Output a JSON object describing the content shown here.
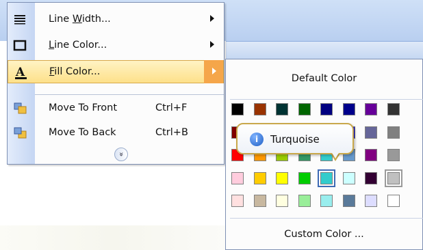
{
  "menu": {
    "items": [
      {
        "label": "Line Width...",
        "shortcut": ""
      },
      {
        "label": "Line Color...",
        "shortcut": ""
      },
      {
        "label": "Fill Color...",
        "shortcut": ""
      },
      {
        "label": "Move To Front",
        "shortcut": "Ctrl+F"
      },
      {
        "label": "Move To Back",
        "shortcut": "Ctrl+B"
      }
    ],
    "expand_glyph": "»"
  },
  "submenu": {
    "default_label": "Default Color",
    "custom_label": "Custom Color ...",
    "palette": [
      [
        "#000000",
        "#993300",
        "#003333",
        "#006600",
        "#000080",
        "#00008b",
        "#660099",
        "#333333"
      ],
      [
        "#800000",
        "#ff6600",
        "#808000",
        "#008000",
        "#0000ff",
        "#0000ff",
        "#666699",
        "#808080"
      ],
      [
        "#ff0000",
        "#ff9900",
        "#99cc00",
        "#339966",
        "#33cccc",
        "#6699cc",
        "#800080",
        "#999999"
      ],
      [
        "#ffccdd",
        "#ffcc00",
        "#ffff00",
        "#00cc00",
        "#33cccc",
        "#ccffff",
        "#330033",
        "#c0c0c0"
      ],
      [
        "#ffe0e0",
        "#c8b8a0",
        "#ffffe0",
        "#99ee99",
        "#99eeee",
        "#5a7a9a",
        "#ddddff",
        "#ffffff"
      ]
    ]
  },
  "tooltip": {
    "text": "Turquoise",
    "icon": "info-icon"
  }
}
